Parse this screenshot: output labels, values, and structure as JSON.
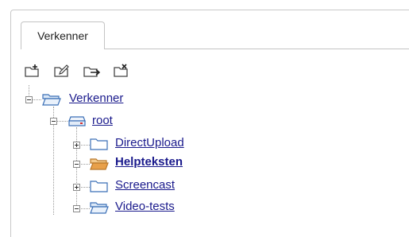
{
  "tab": {
    "label": "Verkenner"
  },
  "toolbar": {
    "items": [
      "add-folder-icon",
      "edit-folder-icon",
      "move-folder-icon",
      "delete-folder-icon"
    ]
  },
  "tree": {
    "root_label": "Verkenner",
    "drive_label": "root",
    "children": [
      {
        "label": "DirectUpload",
        "expanded": false,
        "bold": false
      },
      {
        "label": "Helpteksten",
        "expanded": true,
        "bold": true,
        "highlighted": true
      },
      {
        "label": "Screencast",
        "expanded": false,
        "bold": false
      },
      {
        "label": "Video-tests",
        "expanded": true,
        "bold": false
      }
    ]
  },
  "colors": {
    "link": "#1a1a8c",
    "folder_open": "#3b6fb6",
    "folder_highlight": "#e8a04a"
  }
}
